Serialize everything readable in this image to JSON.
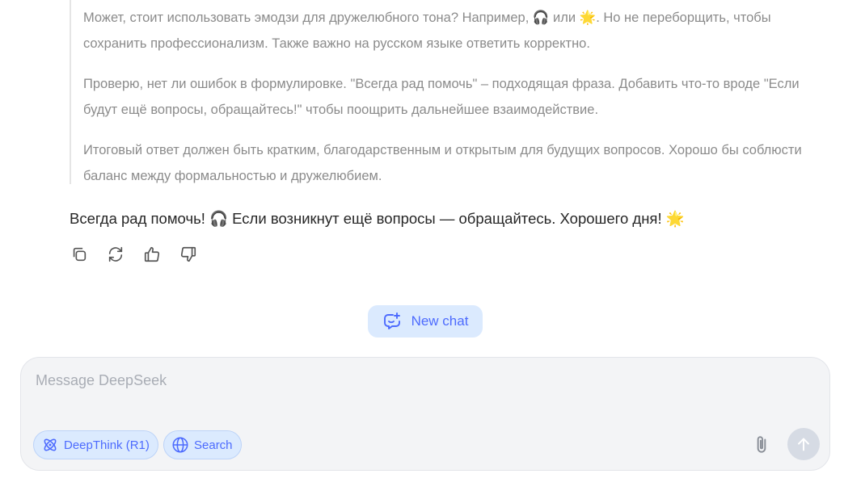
{
  "thinking": {
    "paragraphs": [
      "Может, стоит использовать эмодзи для дружелюбного тона? Например, 🎧 или 🌟. Но не переборщить, чтобы сохранить профессионализм. Также важно на русском языке ответить корректно.",
      "Проверю, нет ли ошибок в формулировке. \"Всегда рад помочь\" – подходящая фраза. Добавить что-то вроде \"Если будут ещё вопросы, обращайтесь!\" чтобы поощрить дальнейшее взаимодействие.",
      "Итоговый ответ должен быть кратким, благодарственным и открытым для будущих вопросов. Хорошо бы соблюсти баланс между формальностью и дружелюбием."
    ]
  },
  "answer": {
    "text": "Всегда рад помочь! 🎧 Если возникнут ещё вопросы — обращайтесь. Хорошего дня! 🌟"
  },
  "actions": [
    {
      "icon": "copy-icon"
    },
    {
      "icon": "regenerate-icon"
    },
    {
      "icon": "thumbs-up-icon"
    },
    {
      "icon": "thumbs-down-icon"
    }
  ],
  "new_chat": {
    "label": "New chat"
  },
  "composer": {
    "placeholder": "Message DeepSeek",
    "deepthink_label": "DeepThink (R1)",
    "search_label": "Search"
  },
  "colors": {
    "accent": "#4d6bfe",
    "chip_bg": "#dbeafe",
    "thinking_text": "#8b8b8b",
    "composer_bg": "#f3f4f6",
    "send_disabled": "#d6dbe4"
  }
}
